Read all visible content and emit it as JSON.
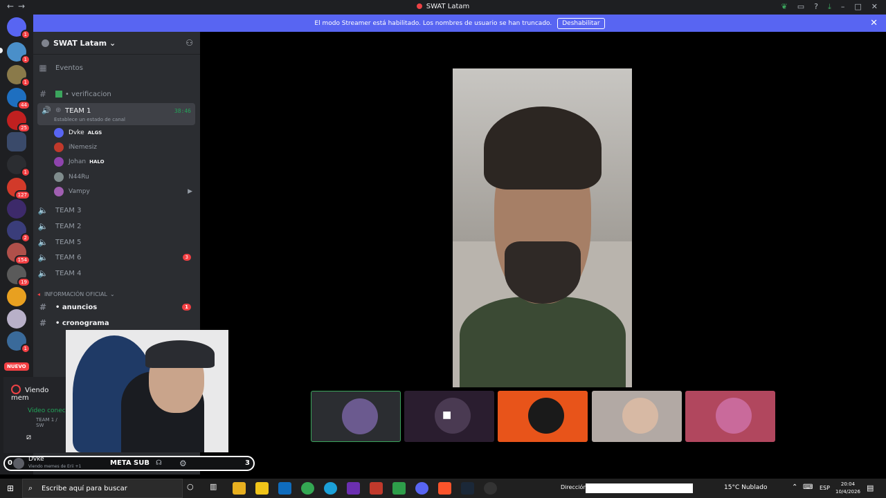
{
  "window": {
    "title": "SWAT Latam"
  },
  "banner": {
    "text": "El modo Streamer está habilitado. Los nombres de usuario se han truncado.",
    "button": "Deshabilitar"
  },
  "guild_badges": [
    "1",
    "1",
    "1",
    "44",
    "25",
    "1",
    "127",
    "2",
    "154",
    "19",
    "1"
  ],
  "server": {
    "name": "SWAT Latam ⌄"
  },
  "channels": {
    "events": "Eventos",
    "verificacion": "• verificacion",
    "team1": {
      "name": "TEAM 1",
      "status": "Establece un estado de canal",
      "time": "38:46"
    },
    "members": [
      {
        "name": "Dvke",
        "tag": "ALGS",
        "color": "#5865f2"
      },
      {
        "name": "iNemesiz",
        "tag": "",
        "color": "#c0392b"
      },
      {
        "name": "Johan",
        "tag": "HALO",
        "color": "#8e44ad"
      },
      {
        "name": "N44Ru",
        "tag": "",
        "color": "#7f8c8d"
      },
      {
        "name": "Vampy",
        "tag": "",
        "color": "#a05fb1"
      }
    ],
    "team3": "TEAM 3",
    "team2": "TEAM 2",
    "team5": "TEAM 5",
    "team6": "TEAM 6",
    "team6_badge": "3",
    "team4": "TEAM 4",
    "category_info": "INFORMACIÓN OFICIAL",
    "anuncios": "• anuncios",
    "anuncios_badge": "1",
    "cronograma": "• cronograma"
  },
  "nuevo": "NUEVO",
  "voice_panel": {
    "live": "Viendo mem",
    "connected": "Video conec",
    "sub": "TEAM 1 / SW"
  },
  "user_panel": {
    "left_num": "0",
    "name": "Dvke",
    "status": "Viendo memes de Erii +1",
    "meta": "META SUB",
    "right_num": "3"
  },
  "taskbar": {
    "search": "Escribe aquí para buscar",
    "address_label": "Dirección",
    "weather": "15°C  Nublado",
    "lang": "ESP",
    "time": "20:04",
    "date": "10/4/2026"
  },
  "tiles": [
    {
      "name": "tile-1",
      "bg": "#2b2d31",
      "pic": "#6b5a8f",
      "border": "#3ba55d"
    },
    {
      "name": "tile-2",
      "bg": "#2a1d2f",
      "pic": "#4a3a52",
      "border": "none"
    },
    {
      "name": "tile-3",
      "bg": "#e8541a",
      "pic": "#1a1a1a",
      "border": "none"
    },
    {
      "name": "tile-4",
      "bg": "#b2a9a4",
      "pic": "#d7b9a4",
      "border": "none"
    },
    {
      "name": "tile-5",
      "bg": "#b1475e",
      "pic": "#c96a9b",
      "border": "none"
    }
  ]
}
